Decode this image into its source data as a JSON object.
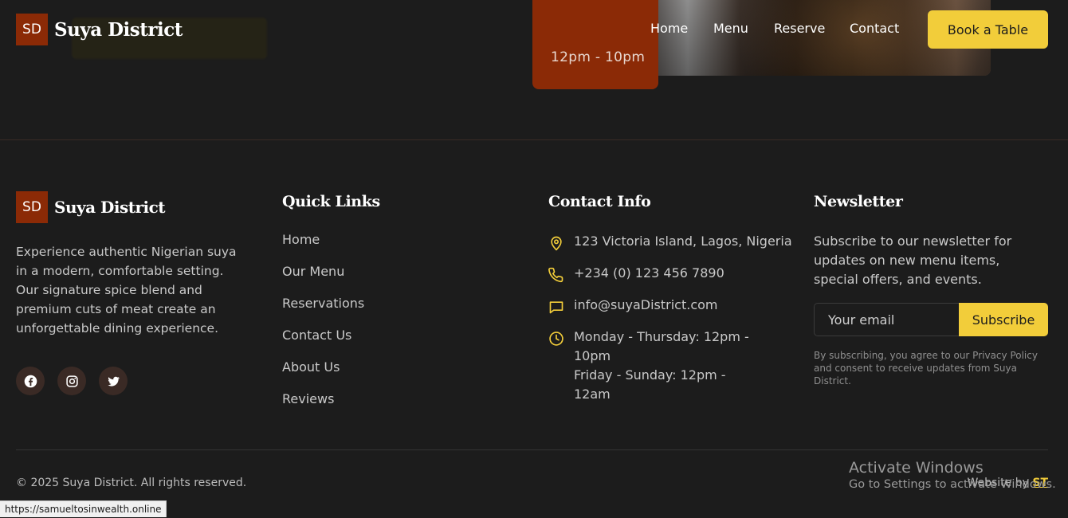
{
  "brand": {
    "initials": "SD",
    "name": "Suya District"
  },
  "nav": {
    "items": [
      "Home",
      "Menu",
      "Reserve",
      "Contact"
    ],
    "cta": "Book a Table"
  },
  "hero": {
    "hours_fragment": "12pm - 10pm"
  },
  "footer": {
    "about": "Experience authentic Nigerian suya in a modern, comfortable setting. Our signature spice blend and premium cuts of meat create an unforgettable dining experience.",
    "socials": [
      "facebook-icon",
      "instagram-icon",
      "twitter-icon"
    ],
    "quick_links": {
      "title": "Quick Links",
      "items": [
        "Home",
        "Our Menu",
        "Reservations",
        "Contact Us",
        "About Us",
        "Reviews"
      ]
    },
    "contact": {
      "title": "Contact Info",
      "address": "123 Victoria Island, Lagos, Nigeria",
      "phone": "+234 (0) 123 456 7890",
      "email": "info@suyaDistrict.com",
      "hours_weekday": "Monday - Thursday: 12pm - 10pm",
      "hours_weekend": "Friday - Sunday: 12pm - 12am"
    },
    "newsletter": {
      "title": "Newsletter",
      "text": "Subscribe to our newsletter for updates on new menu items, special offers, and events.",
      "placeholder": "Your email",
      "button": "Subscribe",
      "note": "By subscribing, you agree to our Privacy Policy and consent to receive updates from Suya District."
    },
    "copyright": "© 2025 Suya District. All rights reserved.",
    "credit_label": "Website by",
    "credit_link": "ST"
  },
  "windows_watermark": {
    "title": "Activate Windows",
    "subtitle": "Go to Settings to activate Windows."
  },
  "status_url": "https://samueltosinwealth.online",
  "colors": {
    "accent": "#f2cd3a",
    "brand": "#8b2a06",
    "background": "#1c1c1c"
  }
}
